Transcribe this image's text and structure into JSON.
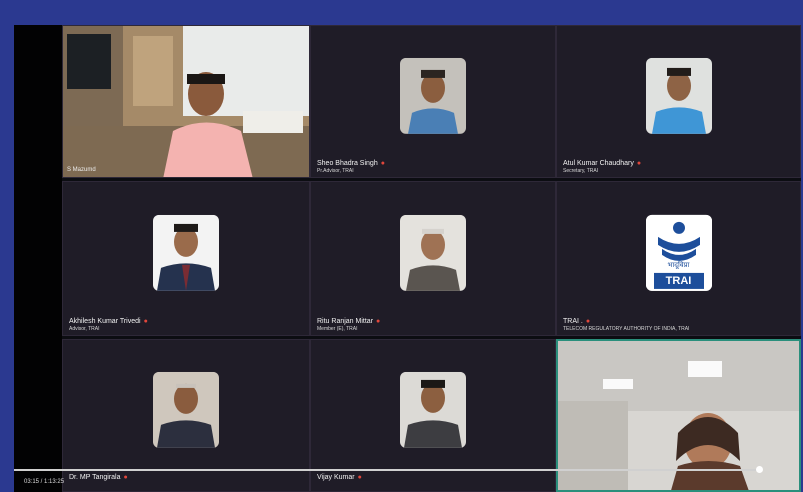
{
  "tiles": [
    {
      "name": "",
      "role": "",
      "overlay": "S Mazumd"
    },
    {
      "name": "Sheo Bhadra Singh",
      "role": "Pr.Advisor, TRAI"
    },
    {
      "name": "Atul Kumar Chaudhary",
      "role": "Secretary, TRAI"
    },
    {
      "name": "Akhilesh Kumar Trivedi",
      "role": "Advisor, TRAI"
    },
    {
      "name": "Ritu Ranjan Mittar",
      "role": "Member (E), TRAI"
    },
    {
      "name": "TRAI .",
      "role": "TELECOM REGULATORY AUTHORITY OF INDIA, TRAI"
    },
    {
      "name": "Dr. MP Tangirala",
      "role": ""
    },
    {
      "name": "Vijay Kumar",
      "role": ""
    },
    {
      "name": "",
      "role": ""
    }
  ],
  "logo": {
    "hindi": "भादूविप्रा",
    "text": "TRAI"
  },
  "footer": {
    "text": "03:15 / 1:13:25"
  },
  "colors": {
    "banner": "#2b3990",
    "tile": "#1f1c27",
    "active_border": "#2a8f7c",
    "mic": "#e0463b",
    "logo_blue": "#1d4e9b"
  }
}
